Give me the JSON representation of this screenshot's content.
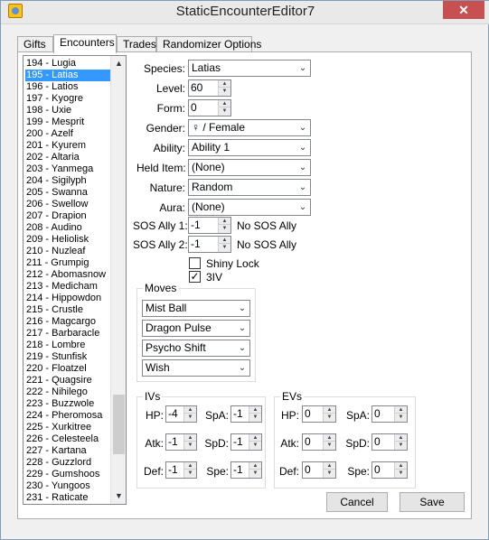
{
  "window": {
    "title": "StaticEncounterEditor7",
    "close_glyph": "✕"
  },
  "tabs": [
    {
      "label": "Gifts"
    },
    {
      "label": "Encounters"
    },
    {
      "label": "Trades"
    },
    {
      "label": "Randomizer Options"
    }
  ],
  "encounter_list": {
    "items": [
      "194 - Lugia",
      "195 - Latias",
      "196 - Latios",
      "197 - Kyogre",
      "198 - Uxie",
      "199 - Mesprit",
      "200 - Azelf",
      "201 - Kyurem",
      "202 - Altaria",
      "203 - Yanmega",
      "204 - Sigilyph",
      "205 - Swanna",
      "206 - Swellow",
      "207 - Drapion",
      "208 - Audino",
      "209 - Heliolisk",
      "210 - Nuzleaf",
      "211 - Grumpig",
      "212 - Abomasnow",
      "213 - Medicham",
      "214 - Hippowdon",
      "215 - Crustle",
      "216 - Magcargo",
      "217 - Barbaracle",
      "218 - Lombre",
      "219 - Stunfisk",
      "220 - Floatzel",
      "221 - Quagsire",
      "222 - Nihilego",
      "223 - Buzzwole",
      "224 - Pheromosa",
      "225 - Xurkitree",
      "226 - Celesteela",
      "227 - Kartana",
      "228 - Guzzlord",
      "229 - Gumshoos",
      "230 - Yungoos",
      "231 - Raticate"
    ],
    "selected_index": 1,
    "scroll_up": "▲",
    "scroll_down": "▼"
  },
  "form": {
    "species": {
      "label": "Species:",
      "value": "Latias"
    },
    "level": {
      "label": "Level:",
      "value": "60"
    },
    "form": {
      "label": "Form:",
      "value": "0"
    },
    "gender": {
      "label": "Gender:",
      "value": "♀ / Female"
    },
    "ability": {
      "label": "Ability:",
      "value": "Ability 1"
    },
    "held_item": {
      "label": "Held Item:",
      "value": "(None)"
    },
    "nature": {
      "label": "Nature:",
      "value": "Random"
    },
    "aura": {
      "label": "Aura:",
      "value": "(None)"
    },
    "sos_ally_1": {
      "label": "SOS Ally 1:",
      "value": "-1",
      "status": "No SOS Ally"
    },
    "sos_ally_2": {
      "label": "SOS Ally 2:",
      "value": "-1",
      "status": "No SOS Ally"
    },
    "shiny_lock": {
      "label": "Shiny Lock",
      "checked": false
    },
    "three_iv": {
      "label": "3IV",
      "checked": true,
      "check_glyph": "✓"
    }
  },
  "moves": {
    "title": "Moves",
    "items": [
      "Mist Ball",
      "Dragon Pulse",
      "Psycho Shift",
      "Wish"
    ]
  },
  "ivs": {
    "title": "IVs",
    "hp": {
      "label": "HP:",
      "value": "-4"
    },
    "atk": {
      "label": "Atk:",
      "value": "-1"
    },
    "def": {
      "label": "Def:",
      "value": "-1"
    },
    "spa": {
      "label": "SpA:",
      "value": "-1"
    },
    "spd": {
      "label": "SpD:",
      "value": "-1"
    },
    "spe": {
      "label": "Spe:",
      "value": "-1"
    }
  },
  "evs": {
    "title": "EVs",
    "hp": {
      "label": "HP:",
      "value": "0"
    },
    "atk": {
      "label": "Atk:",
      "value": "0"
    },
    "def": {
      "label": "Def:",
      "value": "0"
    },
    "spa": {
      "label": "SpA:",
      "value": "0"
    },
    "spd": {
      "label": "SpD:",
      "value": "0"
    },
    "spe": {
      "label": "Spe:",
      "value": "0"
    }
  },
  "buttons": {
    "cancel": "Cancel",
    "save": "Save"
  },
  "glyphs": {
    "dropdown": "⌄",
    "spin_up": "▲",
    "spin_down": "▼"
  },
  "colors": {
    "selection": "#3399ff",
    "close": "#c75050"
  }
}
